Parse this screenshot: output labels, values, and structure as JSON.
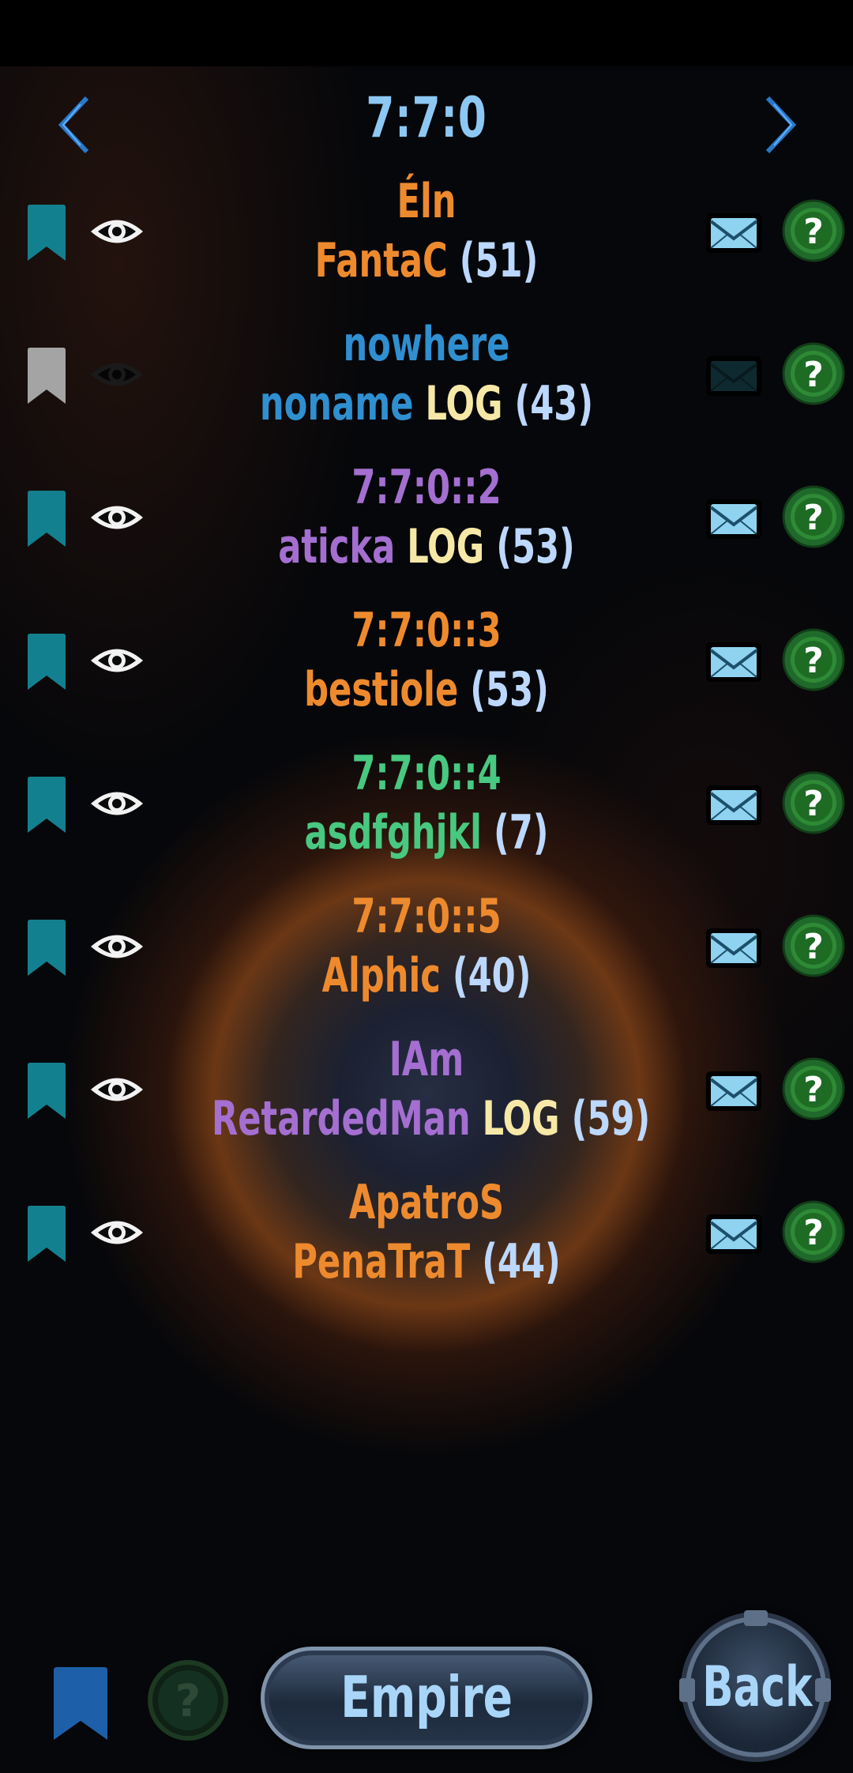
{
  "header": {
    "title": "7:7:0"
  },
  "colors": {
    "orange": "#ee8a2e",
    "blue": "#2f8fd0",
    "purple": "#a46fd0",
    "green": "#48c880",
    "bookmark_active": "#13808f",
    "bookmark_inactive": "#a4a4a4",
    "log": "#f6e8a6",
    "level": "#bcd8ff"
  },
  "rows": [
    {
      "line1": "Éln",
      "name": "FantaC",
      "log": "",
      "level": "(51)",
      "color": "#ee8a2e",
      "active": true
    },
    {
      "line1": "nowhere",
      "name": "noname",
      "log": "LOG",
      "level": "(43)",
      "color": "#2f8fd0",
      "active": false
    },
    {
      "line1": "7:7:0::2",
      "name": "aticka",
      "log": "LOG",
      "level": "(53)",
      "color": "#a46fd0",
      "active": true
    },
    {
      "line1": "7:7:0::3",
      "name": "bestiole",
      "log": "",
      "level": "(53)",
      "color": "#ee8a2e",
      "active": true
    },
    {
      "line1": "7:7:0::4",
      "name": "asdfghjkl",
      "log": "",
      "level": "(7)",
      "color": "#48c880",
      "active": true
    },
    {
      "line1": "7:7:0::5",
      "name": "Alphic",
      "log": "",
      "level": "(40)",
      "color": "#ee8a2e",
      "active": true
    },
    {
      "line1": "IAm",
      "name": "RetardedMan",
      "log": "LOG",
      "level": "(59)",
      "color": "#a46fd0",
      "active": true
    },
    {
      "line1": "ApatroS",
      "name": "PenaTraT",
      "log": "",
      "level": "(44)",
      "color": "#ee8a2e",
      "active": true
    }
  ],
  "footer": {
    "empire_label": "Empire",
    "back_label": "Back"
  }
}
